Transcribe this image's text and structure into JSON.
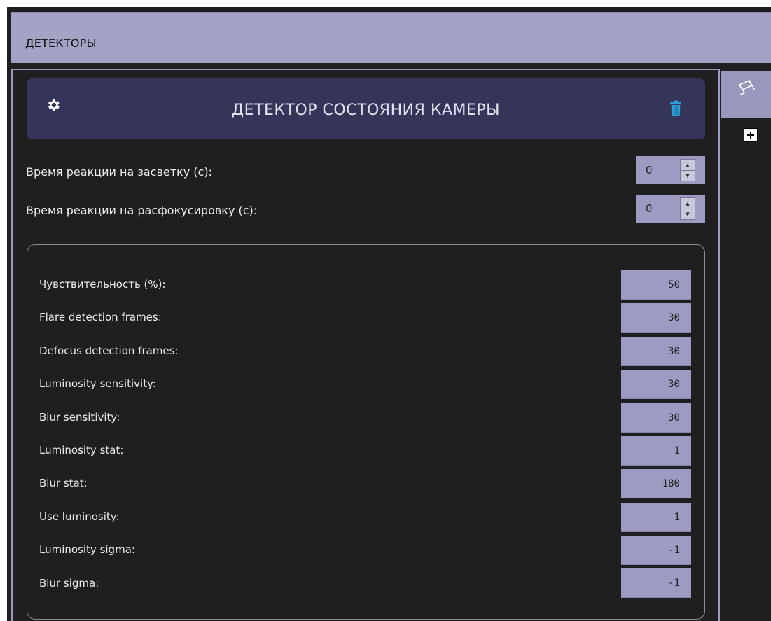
{
  "header": {
    "title": "ДЕТЕКТОРЫ"
  },
  "side": {
    "tab_icon": "security-camera-icon",
    "add_icon": "plus-icon"
  },
  "detector": {
    "title": "ДЕТЕКТОР СОСТОЯНИЯ КАМЕРЫ",
    "settings_icon": "gear-icon",
    "delete_icon": "trash-icon",
    "accent_color": "#2a9fd8"
  },
  "reaction": [
    {
      "label": "Время реакции на засветку (с):",
      "value": "0"
    },
    {
      "label": "Время реакции на расфокусировку (с):",
      "value": "0"
    }
  ],
  "params": [
    {
      "label": "Чувствительность (%):",
      "value": "50"
    },
    {
      "label": "Flare detection frames:",
      "value": "30"
    },
    {
      "label": "Defocus detection frames:",
      "value": "30"
    },
    {
      "label": "Luminosity sensitivity:",
      "value": "30"
    },
    {
      "label": "Blur sensitivity:",
      "value": "30"
    },
    {
      "label": "Luminosity stat:",
      "value": "1"
    },
    {
      "label": "Blur stat:",
      "value": "180"
    },
    {
      "label": "Use luminosity:",
      "value": "1"
    },
    {
      "label": "Luminosity sigma:",
      "value": "-1"
    },
    {
      "label": "Blur sigma:",
      "value": "-1"
    }
  ]
}
